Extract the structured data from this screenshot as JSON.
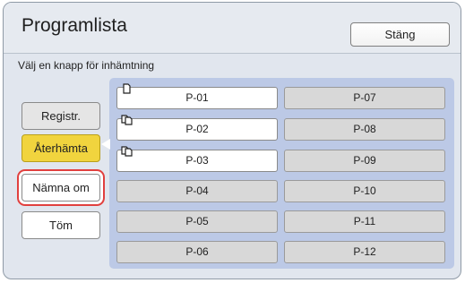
{
  "title": "Programlista",
  "close_label": "Stäng",
  "instruction": "Välj en knapp för inhämtning",
  "side_buttons": {
    "register": "Registr.",
    "retrieve": "Återhämta",
    "rename": "Nämna om",
    "clear": "Töm"
  },
  "programs": [
    {
      "label": "P-01",
      "icon": "single-document-icon"
    },
    {
      "label": "P-02",
      "icon": "multi-document-icon"
    },
    {
      "label": "P-03",
      "icon": "multi-document-icon"
    },
    {
      "label": "P-04"
    },
    {
      "label": "P-05"
    },
    {
      "label": "P-06"
    },
    {
      "label": "P-07"
    },
    {
      "label": "P-08"
    },
    {
      "label": "P-09"
    },
    {
      "label": "P-10"
    },
    {
      "label": "P-11"
    },
    {
      "label": "P-12"
    }
  ],
  "colors": {
    "active_button": "#f1d43e",
    "highlight_outline": "#e1403e",
    "program_area": "#bcc9e6"
  }
}
